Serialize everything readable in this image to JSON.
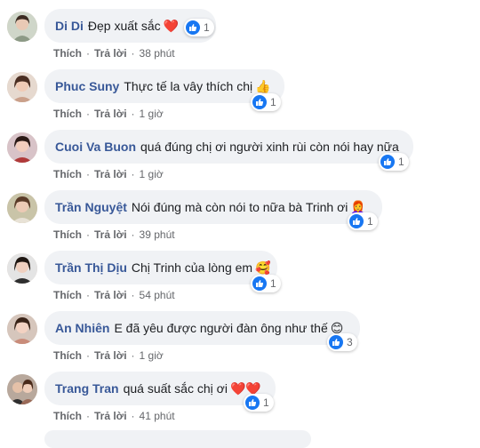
{
  "ui": {
    "like_label": "Thích",
    "reply_label": "Trả lời",
    "separator": "·"
  },
  "comments": [
    {
      "author": "Di Di",
      "text": "Đẹp xuất sắc",
      "emoji": "❤️",
      "like_count": "1",
      "time": "38 phút"
    },
    {
      "author": "Phuc Suny",
      "text": "Thực tế la vây thích chị",
      "emoji": "👍",
      "like_count": "1",
      "time": "1 giờ"
    },
    {
      "author": "Cuoi Va Buon",
      "text": "quá đúng chị ơi người xinh rùi còn nói hay nữa",
      "emoji": "",
      "like_count": "1",
      "time": "1 giờ"
    },
    {
      "author": "Trần Nguyệt",
      "text": "Nói đúng mà còn nói to nữa bà Trinh ơi",
      "emoji": "👩‍🦰",
      "like_count": "1",
      "time": "39 phút"
    },
    {
      "author": "Trần Thị Dịu",
      "text": "Chị Trinh của lòng em",
      "emoji": "🥰",
      "like_count": "1",
      "time": "54 phút"
    },
    {
      "author": "An Nhiên",
      "text": "E đã yêu được người đàn ông như thế",
      "emoji": "😊",
      "like_count": "3",
      "time": "1 giờ"
    },
    {
      "author": "Trang Tran",
      "text": "quá suất sắc chị ơi",
      "emoji": "❤️❤️",
      "like_count": "1",
      "time": "41 phút"
    }
  ]
}
